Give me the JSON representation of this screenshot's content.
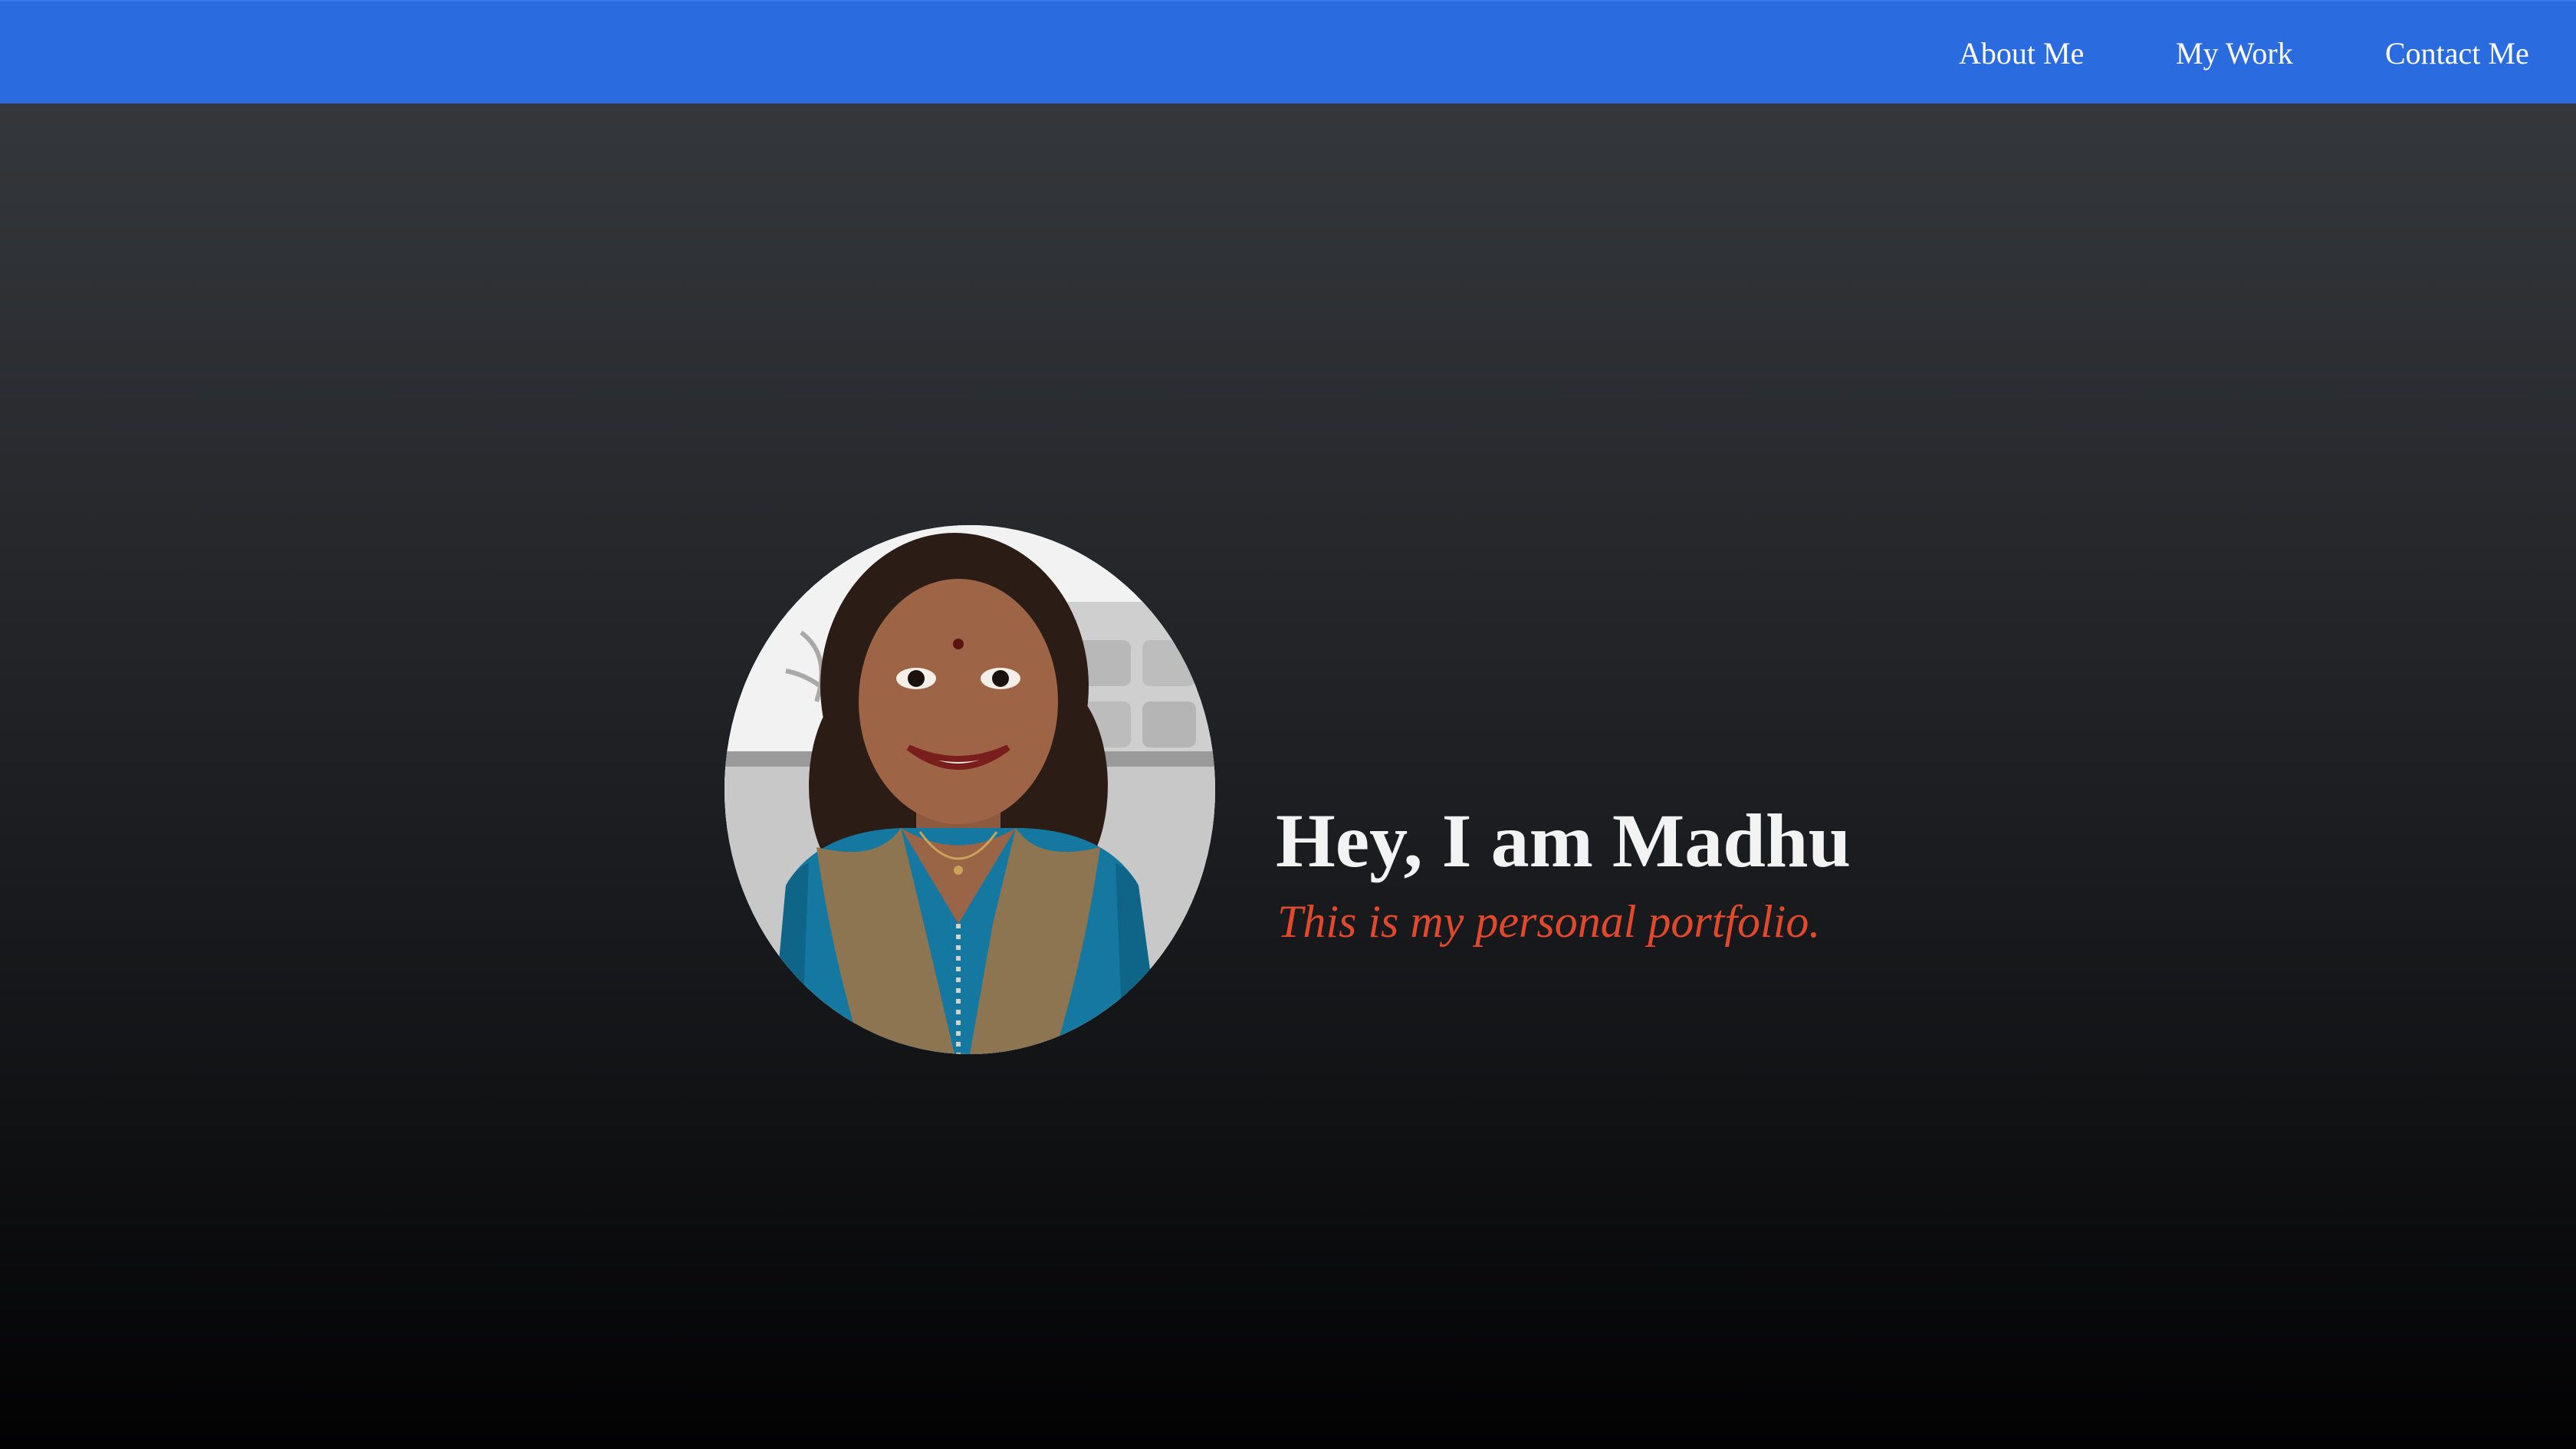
{
  "nav": {
    "links": [
      {
        "label": "About Me"
      },
      {
        "label": "My Work"
      },
      {
        "label": "Contact Me"
      }
    ]
  },
  "hero": {
    "title": "Hey, I am Madhu",
    "subtitle": "This is my personal portfolio."
  },
  "colors": {
    "navbar": "#2a6ce0",
    "title": "#f3f3f3",
    "subtitle": "#e2482c",
    "background_top": "#34373b",
    "background_bottom": "#020203"
  }
}
